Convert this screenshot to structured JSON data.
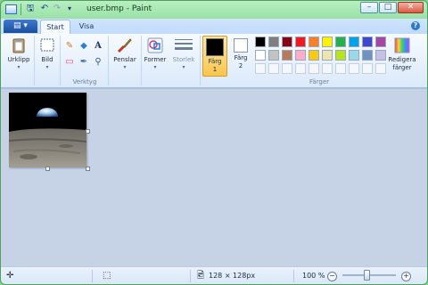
{
  "window": {
    "title": "user.bmp - Paint",
    "controls": {
      "minimize": "–",
      "maximize": "□",
      "close": "✕"
    }
  },
  "quick_access": [
    {
      "icon": "save-icon",
      "glyph": "🖫"
    },
    {
      "icon": "undo-icon",
      "glyph": "↶"
    },
    {
      "icon": "redo-icon",
      "glyph": "↷"
    },
    {
      "icon": "customize-dropdown-icon",
      "glyph": "▾"
    }
  ],
  "tabs": {
    "app_menu": "▤ ▾",
    "start": "Start",
    "view": "Visa",
    "help": "?"
  },
  "ribbon": {
    "clipboard": {
      "label": "Urklipp",
      "icon": "clipboard-icon"
    },
    "image": {
      "label": "Bild",
      "icon": "select-icon"
    },
    "tools_group": "Verktyg",
    "tools": {
      "pencil": "✎",
      "fill": "◆",
      "text": "A",
      "eraser": "▭",
      "picker": "✒",
      "magnifier": "⚲"
    },
    "brushes": {
      "label": "Penslar"
    },
    "shapes": {
      "label": "Former"
    },
    "size": {
      "label": "Storlek"
    },
    "color1": {
      "label_line1": "Färg",
      "label_line2": "1",
      "color": "#000000"
    },
    "color2": {
      "label_line1": "Färg",
      "label_line2": "2",
      "color": "#ffffff"
    },
    "colors_group": "Färger",
    "edit_colors": {
      "label_line1": "Redigera",
      "label_line2": "färger"
    },
    "dropdown": "▾"
  },
  "palette": {
    "row1": [
      "#000000",
      "#7f7f7f",
      "#880015",
      "#ed1c24",
      "#ff7f27",
      "#fff200",
      "#22b14c",
      "#00a2e8",
      "#3f48cc",
      "#a349a4"
    ],
    "row2": [
      "#ffffff",
      "#c3c3c3",
      "#b97a57",
      "#ffaec9",
      "#ffc90e",
      "#efe4b0",
      "#b5e61d",
      "#99d9ea",
      "#7092be",
      "#c8bfe7"
    ]
  },
  "status": {
    "cursor_icon": "✛",
    "selection_icon": "⬚",
    "image_size_icon": "🖻",
    "image_size": "128 × 128px",
    "zoom": "100 %",
    "zoom_out": "−",
    "zoom_in": "+",
    "zoom_level": 0.45
  }
}
